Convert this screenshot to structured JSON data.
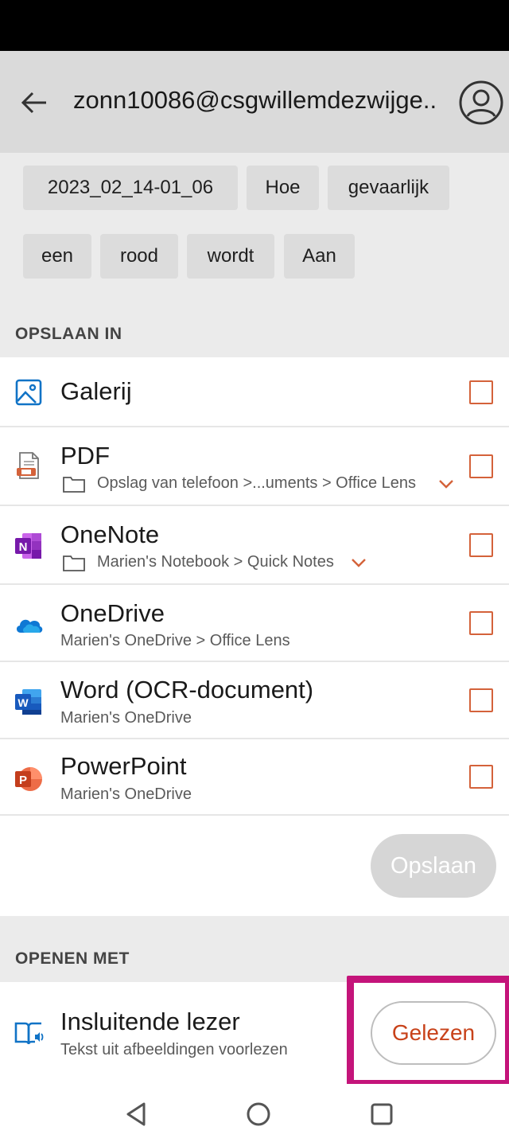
{
  "header": {
    "account": "zonn10086@csgwillemdezwijge..",
    "back_icon": "arrow-left-icon",
    "avatar_icon": "account-circle-icon"
  },
  "tags": [
    "2023_02_14-01_06",
    "Hoe",
    "gevaarlijk",
    "een",
    "rood",
    "wordt",
    "Aan"
  ],
  "save_in": {
    "header": "OPSLAAN IN",
    "items": [
      {
        "title": "Galerij",
        "subtitle": "",
        "icon": "gallery-icon"
      },
      {
        "title": "PDF",
        "subtitle": "Opslag van telefoon >...uments > Office Lens",
        "icon": "pdf-icon"
      },
      {
        "title": "OneNote",
        "subtitle": "Marien's Notebook > Quick Notes",
        "icon": "onenote-icon"
      },
      {
        "title": "OneDrive",
        "subtitle": "Marien's OneDrive > Office Lens",
        "icon": "onedrive-icon"
      },
      {
        "title": "Word (OCR-document)",
        "subtitle": "Marien's OneDrive",
        "icon": "word-icon"
      },
      {
        "title": "PowerPoint",
        "subtitle": "Marien's OneDrive",
        "icon": "powerpoint-icon"
      }
    ],
    "save_label": "Opslaan"
  },
  "open_with": {
    "header": "OPENEN MET",
    "title": "Insluitende lezer",
    "subtitle": "Tekst uit afbeeldingen voorlezen",
    "button_label": "Gelezen",
    "icon": "immersive-reader-icon"
  },
  "colors": {
    "accent": "#d4623a",
    "highlight": "#c4147a",
    "onenote": "#7719aa",
    "onedrive": "#0f78d4",
    "word": "#185abd",
    "powerpoint": "#c43e1c"
  }
}
